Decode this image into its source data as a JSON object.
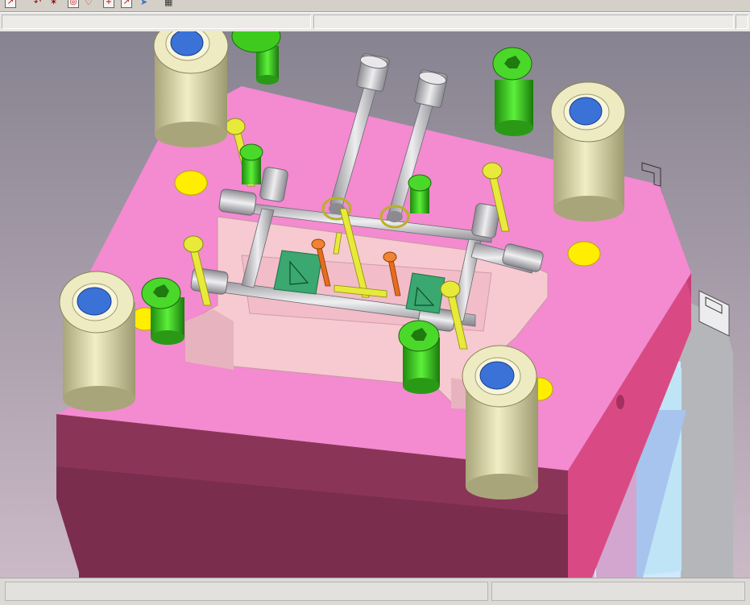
{
  "window": {
    "toolbar": {
      "icons": [
        {
          "name": "sketch-tool-icon"
        },
        {
          "name": "arc-tool-icon"
        },
        {
          "name": "point-tool-icon"
        },
        {
          "name": "circle-target-icon"
        },
        {
          "name": "heart-shape-icon"
        },
        {
          "name": "cross-add-icon"
        },
        {
          "name": "line-tool-icon"
        },
        {
          "name": "cursor-arrow-icon"
        },
        {
          "name": "grid-view-icon"
        }
      ]
    },
    "status_fields": [
      "",
      "",
      ""
    ],
    "bottom_fields": [
      "",
      ""
    ]
  },
  "scene": {
    "model": "injection-mold-assembly",
    "colors": {
      "background_top": "#8a8690",
      "background_bottom": "#c9b7c4",
      "plate_top": "#f48ad0",
      "plate_front": "#7a2c4c",
      "plate_side": "#d6487f",
      "cavity": "#f7c9d0",
      "guide_bushing": "#e5e2b2",
      "bushing_bore": "#3a72d8",
      "cap_screw": "#3ecb1e",
      "yellow_pin": "#e8ea3a",
      "orange_pin": "#e76c1c",
      "insert": "#3aa870",
      "cooling_pipe": "#b9b9bd",
      "lower_plate": "#3e3e44",
      "side_plate": "#b4b6ba",
      "ejector_stripe_light": "#cfe8ff",
      "ejector_stripe_blue": "#8fa8ea",
      "ejector_stripe_pink": "#d2a6cf"
    }
  }
}
